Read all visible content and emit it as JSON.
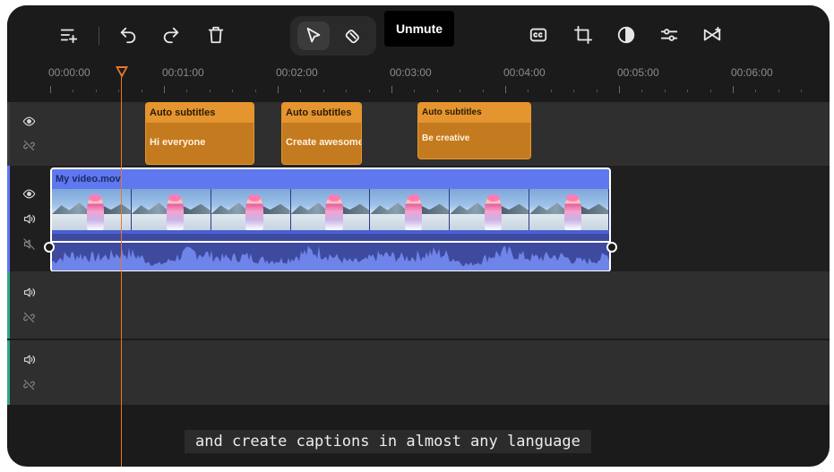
{
  "toolbar": {
    "tooltip": "Unmute",
    "left_tools": [
      "add-track-icon",
      "undo-icon",
      "redo-icon",
      "delete-icon"
    ],
    "mode_tools": [
      "select-tool-icon",
      "blade-tool-icon"
    ],
    "right_tools": [
      "captions-icon",
      "crop-icon",
      "color-adjust-icon",
      "adjust-sliders-icon",
      "transition-icon"
    ]
  },
  "ruler": {
    "labels": [
      "00:00:00",
      "00:01:00",
      "00:02:00",
      "00:03:00",
      "00:04:00",
      "00:05:00",
      "00:06:00"
    ]
  },
  "playhead": {
    "color": "#e8772e"
  },
  "subtitle_track": {
    "clips": [
      {
        "title": "Auto subtitles",
        "text": "Hi everyone"
      },
      {
        "title": "Auto subtitles",
        "text": "Create awesome c"
      },
      {
        "title": "Auto subtitles",
        "text": "Be creative"
      }
    ],
    "accent": "#e5952f"
  },
  "video_track": {
    "clip_name": "My video.mov",
    "accent": "#5f78f0",
    "thumbnail_count": 7
  },
  "caption": {
    "text": "and create captions in almost any language"
  }
}
